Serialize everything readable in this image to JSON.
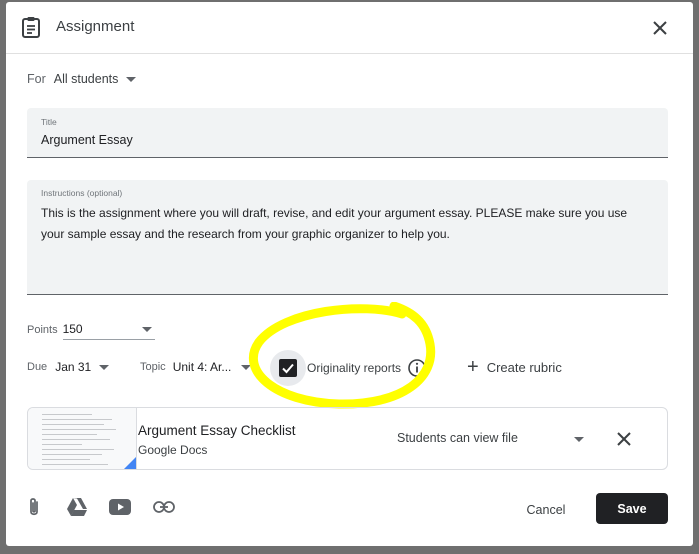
{
  "header": {
    "title": "Assignment",
    "icon": "assignment-icon",
    "close_icon": "close-icon"
  },
  "for": {
    "label": "For",
    "value": "All students"
  },
  "title_field": {
    "label": "Title",
    "value": "Argument Essay"
  },
  "instructions_field": {
    "label": "Instructions (optional)",
    "value": "This is the assignment where you will draft, revise, and edit your argument essay. PLEASE make sure you use your sample essay and the research from your graphic organizer to help you."
  },
  "points": {
    "label": "Points",
    "value": "150"
  },
  "due": {
    "label": "Due",
    "value": "Jan 31"
  },
  "topic": {
    "label": "Topic",
    "value": "Unit 4: Ar..."
  },
  "originality": {
    "label": "Originality reports",
    "checked": true
  },
  "rubric": {
    "label": "Create rubric"
  },
  "attachment": {
    "title": "Argument Essay Checklist",
    "type": "Google Docs",
    "share_option": "Students can view file"
  },
  "toolbar": {
    "icons": [
      "paperclip-icon",
      "google-drive-icon",
      "youtube-icon",
      "link-icon"
    ]
  },
  "actions": {
    "cancel": "Cancel",
    "save": "Save"
  },
  "colors": {
    "highlight": "#ffff00",
    "primary_button": "#202124",
    "field_bg": "#f1f3f4",
    "backdrop": "#6f6f6f"
  }
}
